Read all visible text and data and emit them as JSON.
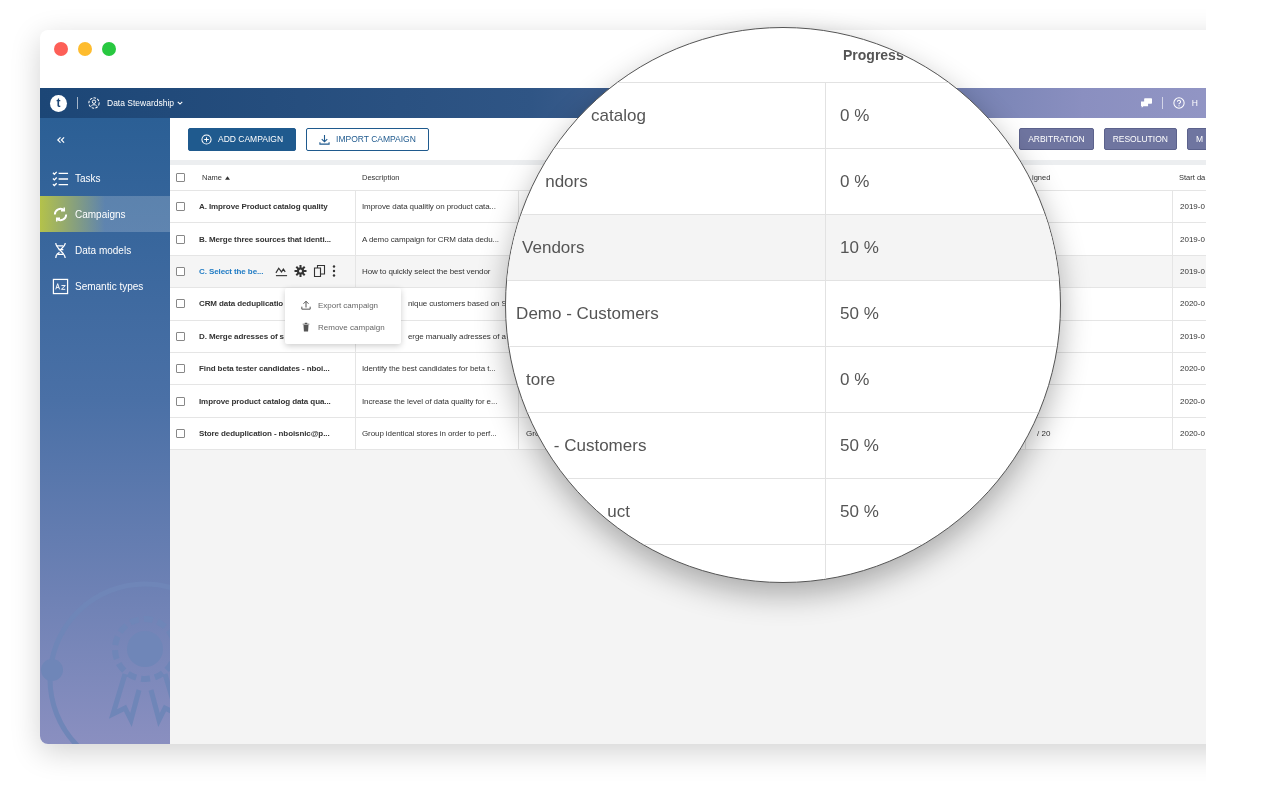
{
  "window": {
    "controls": [
      {
        "color": "#fd5f57"
      },
      {
        "color": "#febc2e"
      },
      {
        "color": "#28c840"
      }
    ]
  },
  "header": {
    "logo": "t",
    "app": "Data Stewardship",
    "help": "H"
  },
  "sidebar": {
    "items": [
      {
        "label": "Tasks",
        "kind": "tasks",
        "selected": false
      },
      {
        "label": "Campaigns",
        "kind": "campaigns",
        "selected": true
      },
      {
        "label": "Data models",
        "kind": "models",
        "selected": false
      },
      {
        "label": "Semantic types",
        "kind": "types",
        "selected": false
      }
    ]
  },
  "toolbar": {
    "left_buttons": [
      {
        "label": "ADD CAMPAIGN",
        "kind": "add"
      },
      {
        "label": "IMPORT CAMPAIGN",
        "kind": "import"
      }
    ],
    "right_buttons": [
      "ARBITRATION",
      "RESOLUTION",
      "M"
    ]
  },
  "table": {
    "all_checked": false,
    "columns": [
      {
        "label": "Name",
        "sorted": true
      },
      {
        "label": "Description"
      },
      {
        "label": "igned"
      },
      {
        "label": "Start da"
      }
    ],
    "rows": [
      {
        "name": "A. Improve Product catalog quality",
        "description": "Improve data qualitly on product cata...",
        "start": "2019-0",
        "checked": false,
        "hovered": false
      },
      {
        "name": "B. Merge three sources that identi...",
        "description": "A demo campaign for CRM data dedu...",
        "start": "2019-0",
        "checked": false,
        "hovered": false
      },
      {
        "name": "C. Select the be...",
        "description": "How to quickly select the best vendor",
        "start": "2019-0",
        "checked": false,
        "hovered": true
      },
      {
        "name": "CRM data deduplicatio",
        "description": "nique customers based on S",
        "start": "2020-0",
        "checked": false,
        "hovered": false
      },
      {
        "name": "D. Merge adresses of s",
        "description": "erge manually adresses of a",
        "start": "2019-0",
        "checked": false,
        "hovered": false
      },
      {
        "name": "Find beta tester candidates - nboi...",
        "description": "Identify the best candidates for beta t...",
        "start": "2020-0",
        "checked": false,
        "hovered": false
      },
      {
        "name": "Improve product catalog data qua...",
        "description": "Increase the level of data quality for e...",
        "start": "2020-0",
        "checked": false,
        "hovered": false
      },
      {
        "name": "Store deduplication - nboisnic@p...",
        "description": "Group identical stores in order to perf...",
        "column_3": "Gro",
        "assigned": "/ 20",
        "start": "2020-0",
        "checked": false,
        "hovered": false
      }
    ]
  },
  "context_menu": {
    "items": [
      {
        "label": "Export campaign",
        "kind": "export"
      },
      {
        "label": "Remove campaign",
        "kind": "remove"
      }
    ]
  },
  "magnifier": {
    "header": "Progress",
    "rows": [
      {
        "name": "catalog",
        "progress": "0 %",
        "hovered": false
      },
      {
        "name": "ndors",
        "progress": "0 %",
        "hovered": false
      },
      {
        "name": "Vendors",
        "progress": "10 %",
        "hovered": true
      },
      {
        "name": "Demo - Customers",
        "progress": "50 %",
        "hovered": false
      },
      {
        "name": "tore",
        "progress": "0 %",
        "hovered": false
      },
      {
        "name": "- Customers",
        "progress": "50 %",
        "hovered": false
      },
      {
        "name": "uct",
        "progress": "50 %",
        "hovered": false
      }
    ]
  }
}
